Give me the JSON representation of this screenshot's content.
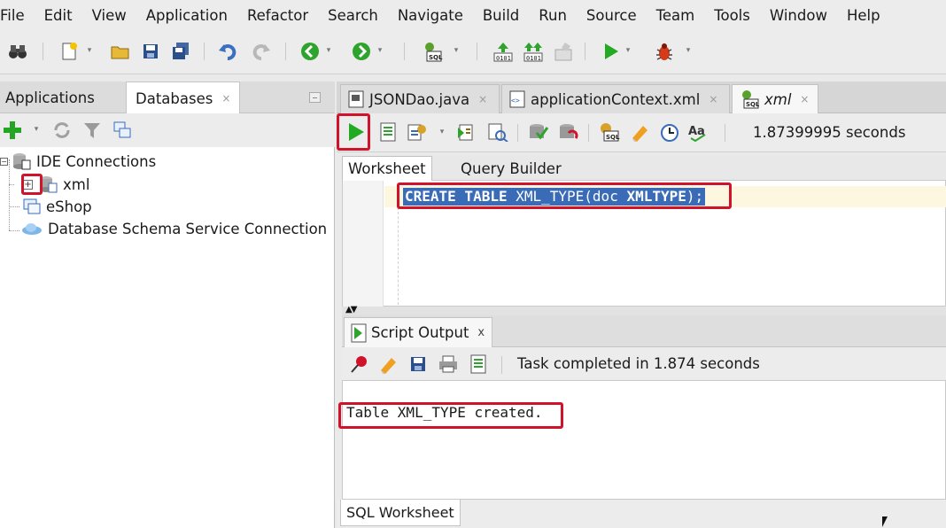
{
  "menu": [
    "File",
    "Edit",
    "View",
    "Application",
    "Refactor",
    "Search",
    "Navigate",
    "Build",
    "Run",
    "Source",
    "Team",
    "Tools",
    "Window",
    "Help"
  ],
  "left_panel": {
    "tabs": [
      {
        "label": "Applications"
      },
      {
        "label": "Databases",
        "close": "×"
      }
    ],
    "tree": {
      "root": "IDE Connections",
      "children": [
        "xml",
        "eShop",
        "Database Schema Service Connection"
      ],
      "expander": "+"
    }
  },
  "editor": {
    "tabs": [
      {
        "label": "JSONDao.java",
        "close": "×"
      },
      {
        "label": "applicationContext.xml",
        "close": "×"
      },
      {
        "label": "xml",
        "close": "×"
      }
    ],
    "elapsed": "1.87399995 seconds",
    "sub_tabs": [
      "Worksheet",
      "Query Builder"
    ],
    "code": {
      "kw1": "CREATE TABLE",
      "mid": " XML_TYPE(doc ",
      "kw2": "XMLTYPE",
      "end": ");"
    }
  },
  "output": {
    "tab_label": "Script Output",
    "tab_close": "x",
    "status": "Task completed in 1.874 seconds",
    "text": "Table XML_TYPE created."
  },
  "bottom_tab": "SQL Worksheet",
  "colors": {
    "highlight": "#d0122b",
    "selection": "#3a6bb7",
    "run_green": "#22aa22"
  }
}
